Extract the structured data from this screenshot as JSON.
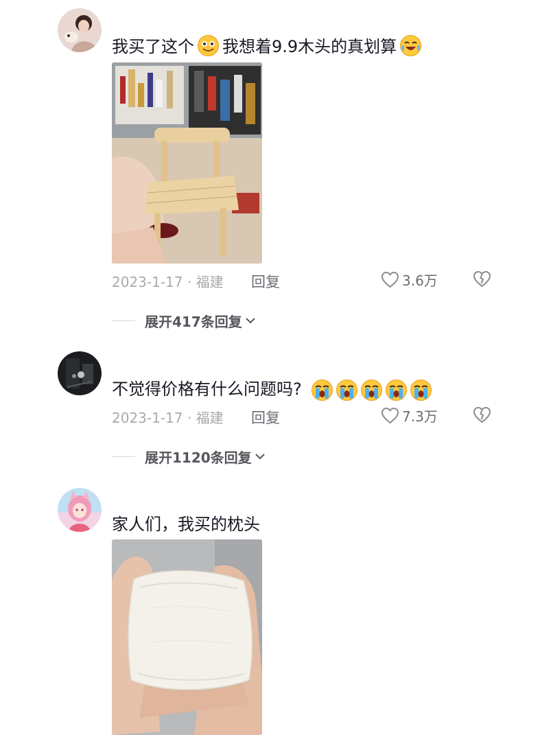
{
  "comments": [
    {
      "text_before": "我买了这个",
      "text_after": "我想着9.9木头的真划算",
      "image_alt": "small wooden chair phone stand held in hand",
      "date_location": "2023-1-17 · 福建",
      "reply_label": "回复",
      "likes": "3.6万",
      "expand_label": "展开417条回复"
    },
    {
      "text": "不觉得价格有什么问题吗?",
      "date_location": "2023-1-17 · 福建",
      "reply_label": "回复",
      "likes": "7.3万",
      "expand_label": "展开1120条回复"
    },
    {
      "text": "家人们，我买的枕头",
      "image_alt": "tiny white pillow held in palm"
    }
  ],
  "icons": {
    "like": "heart-outline-icon",
    "dislike": "broken-heart-icon",
    "expand": "chevron-down-icon"
  },
  "colors": {
    "text": "#161823",
    "meta": "#a8a9ae",
    "action": "#6b6c73"
  }
}
